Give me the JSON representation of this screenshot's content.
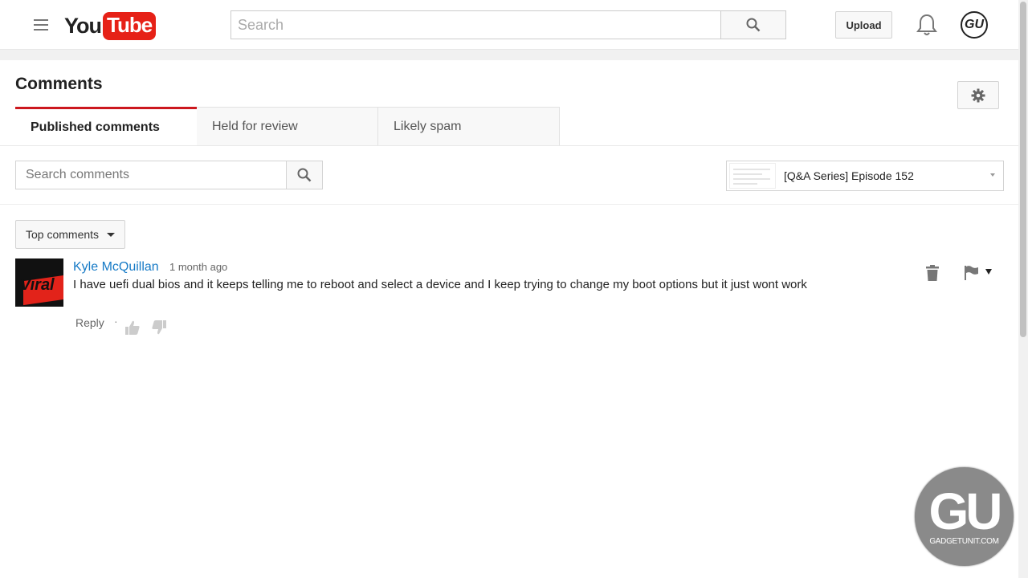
{
  "header": {
    "logo_you": "You",
    "logo_tube": "Tube",
    "search_placeholder": "Search",
    "upload_label": "Upload",
    "avatar_text": "GU"
  },
  "page": {
    "title": "Comments"
  },
  "tabs": [
    {
      "label": "Published comments",
      "active": true
    },
    {
      "label": "Held for review",
      "active": false
    },
    {
      "label": "Likely spam",
      "active": false
    }
  ],
  "filters": {
    "search_placeholder": "Search comments",
    "video_title": "[Q&A Series] Episode 152",
    "sort_label": "Top comments"
  },
  "comments": [
    {
      "author": "Kyle McQuillan",
      "time": "1 month ago",
      "text": "I have uefi dual bios and it keeps telling me to reboot and select a device and I keep trying to change my boot options but it just wont work",
      "avatar_text": "Viral",
      "reply_label": "Reply",
      "separator": "·"
    }
  ],
  "watermark": {
    "big": "GU",
    "small": "GADGETUNIT.COM"
  },
  "colors": {
    "brand_red": "#e62117",
    "active_tab": "#cc181e",
    "author_link": "#167ac6"
  }
}
